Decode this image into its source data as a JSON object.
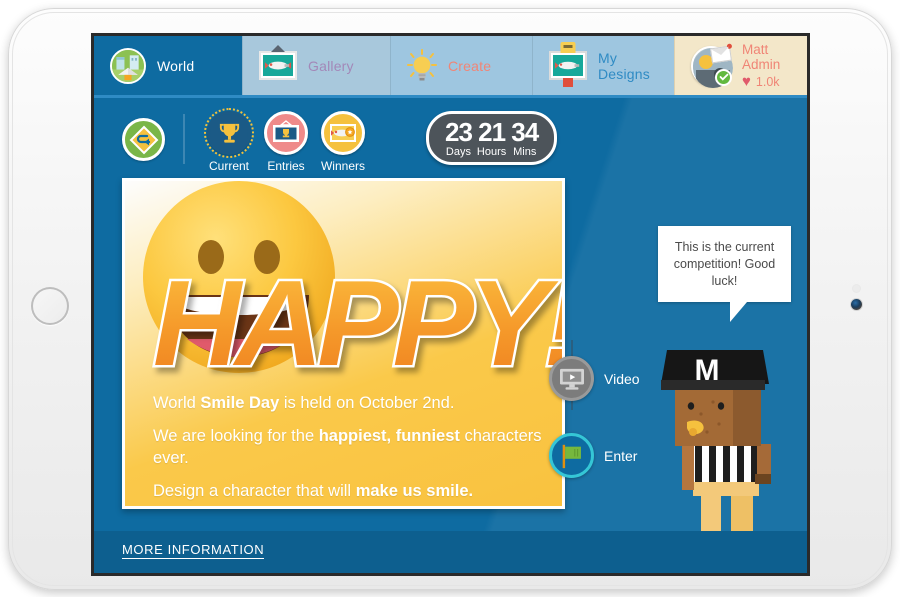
{
  "nav": {
    "tabs": [
      {
        "id": "world",
        "label": "World",
        "icon": "world-globe-icon"
      },
      {
        "id": "gallery",
        "label": "Gallery",
        "icon": "picture-frame-icon"
      },
      {
        "id": "create",
        "label": "Create",
        "icon": "lightbulb-icon"
      },
      {
        "id": "designs",
        "label": "My Designs",
        "icon": "robot-frame-icon"
      }
    ],
    "account": {
      "name": "Matt Admin",
      "likes": "1.0k",
      "heart": "♥",
      "avatar_icon": "user-avatar-icon",
      "status_icon": "online-check-icon",
      "mail_icon": "mail-notification-icon"
    }
  },
  "toolbar": {
    "back_label": "back-arrow",
    "items": [
      {
        "id": "current",
        "label": "Current",
        "icon": "trophy-icon"
      },
      {
        "id": "entries",
        "label": "Entries",
        "icon": "entries-frame-icon"
      },
      {
        "id": "winners",
        "label": "Winners",
        "icon": "winners-medal-icon"
      }
    ]
  },
  "countdown": {
    "units": [
      {
        "value": "23",
        "label": "Days"
      },
      {
        "value": "21",
        "label": "Hours"
      },
      {
        "value": "34",
        "label": "Mins"
      }
    ]
  },
  "banner": {
    "headline": "HAPPY!",
    "emoji": "grinning-smiley-face",
    "lines": [
      {
        "pre": "World ",
        "bold": "Smile Day",
        "post": " is held on October 2nd."
      },
      {
        "pre": "We are looking for the ",
        "bold": "happiest, funniest",
        "post": " characters ever."
      },
      {
        "pre": "Design a character that will ",
        "bold": "make us smile.",
        "post": ""
      }
    ]
  },
  "side_actions": [
    {
      "id": "video",
      "label": "Video",
      "icon": "video-play-icon"
    },
    {
      "id": "enter",
      "label": "Enter",
      "icon": "green-flag-icon"
    }
  ],
  "speech_bubble": {
    "text": "This is the current competition! Good luck!"
  },
  "character": {
    "cap_letter": "M",
    "description": "referee-character"
  },
  "footer": {
    "more_info_label": "MORE INFORMATION"
  },
  "colors": {
    "screen_blue": "#0e6ba1",
    "footer_blue": "#0d5f8f",
    "tab_light_blue": "#9ec6e0",
    "tab_gallery_blue": "#a8c8dc",
    "account_cream": "#f3e7c9",
    "accent_salmon": "#f08576",
    "accent_purple": "#a388b8",
    "accent_yellow": "#f5c13e",
    "banner_yellow": "#f9c23f",
    "enter_teal": "#35c6d6"
  }
}
